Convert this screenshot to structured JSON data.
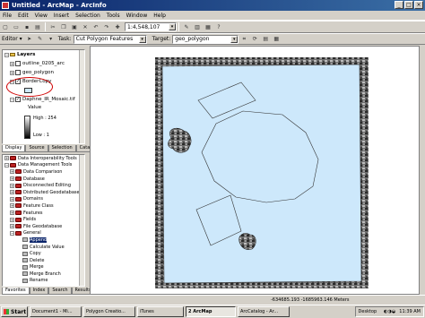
{
  "window": {
    "title": "Untitled - ArcMap - ArcInfo"
  },
  "menu": [
    "File",
    "Edit",
    "View",
    "Insert",
    "Selection",
    "Tools",
    "Window",
    "Help"
  ],
  "toolbar": {
    "scale": "1:4,548,107"
  },
  "editor": {
    "editor_label": "Editor ▾",
    "task_label": "Task:",
    "task_value": "Cut Polygon Features",
    "target_label": "Target:",
    "target_value": "geo_polygon"
  },
  "toc": {
    "root": "Layers",
    "layers": [
      {
        "name": "outline_0205_arc",
        "checked": false
      },
      {
        "name": "geo_polygon",
        "checked": false
      },
      {
        "name": "BorderCopy",
        "checked": true
      },
      {
        "name": "Daphne_IR_Mosaic.tif",
        "checked": true
      }
    ],
    "legend": {
      "value": "Value",
      "high": "High : 254",
      "low": "Low : 1"
    },
    "tabs": [
      "Display",
      "Source",
      "Selection",
      "Catalog"
    ]
  },
  "toolbox": {
    "items": [
      "Data Interoperability Tools",
      "Data Management Tools",
      "Data Comparison",
      "Database",
      "Disconnected Editing",
      "Distributed Geodatabase",
      "Domains",
      "Feature Class",
      "Features",
      "Fields",
      "File Geodatabase",
      "General",
      "Append",
      "Calculate Value",
      "Copy",
      "Delete",
      "Merge",
      "Merge Branch",
      "Rename"
    ],
    "tabs": [
      "Favorites",
      "Index",
      "Search",
      "Results"
    ]
  },
  "status": {
    "coords": "-634685.193 -1685963.146 Meters"
  },
  "taskbar": {
    "start": "Start",
    "tasks": [
      "Document1 - Mi...",
      "Polygon Creatio...",
      "iTunes",
      "2 ArcMap",
      "ArcCatalog - Ar..."
    ],
    "tray_label": "Desktop",
    "clock": "11:39 AM"
  }
}
